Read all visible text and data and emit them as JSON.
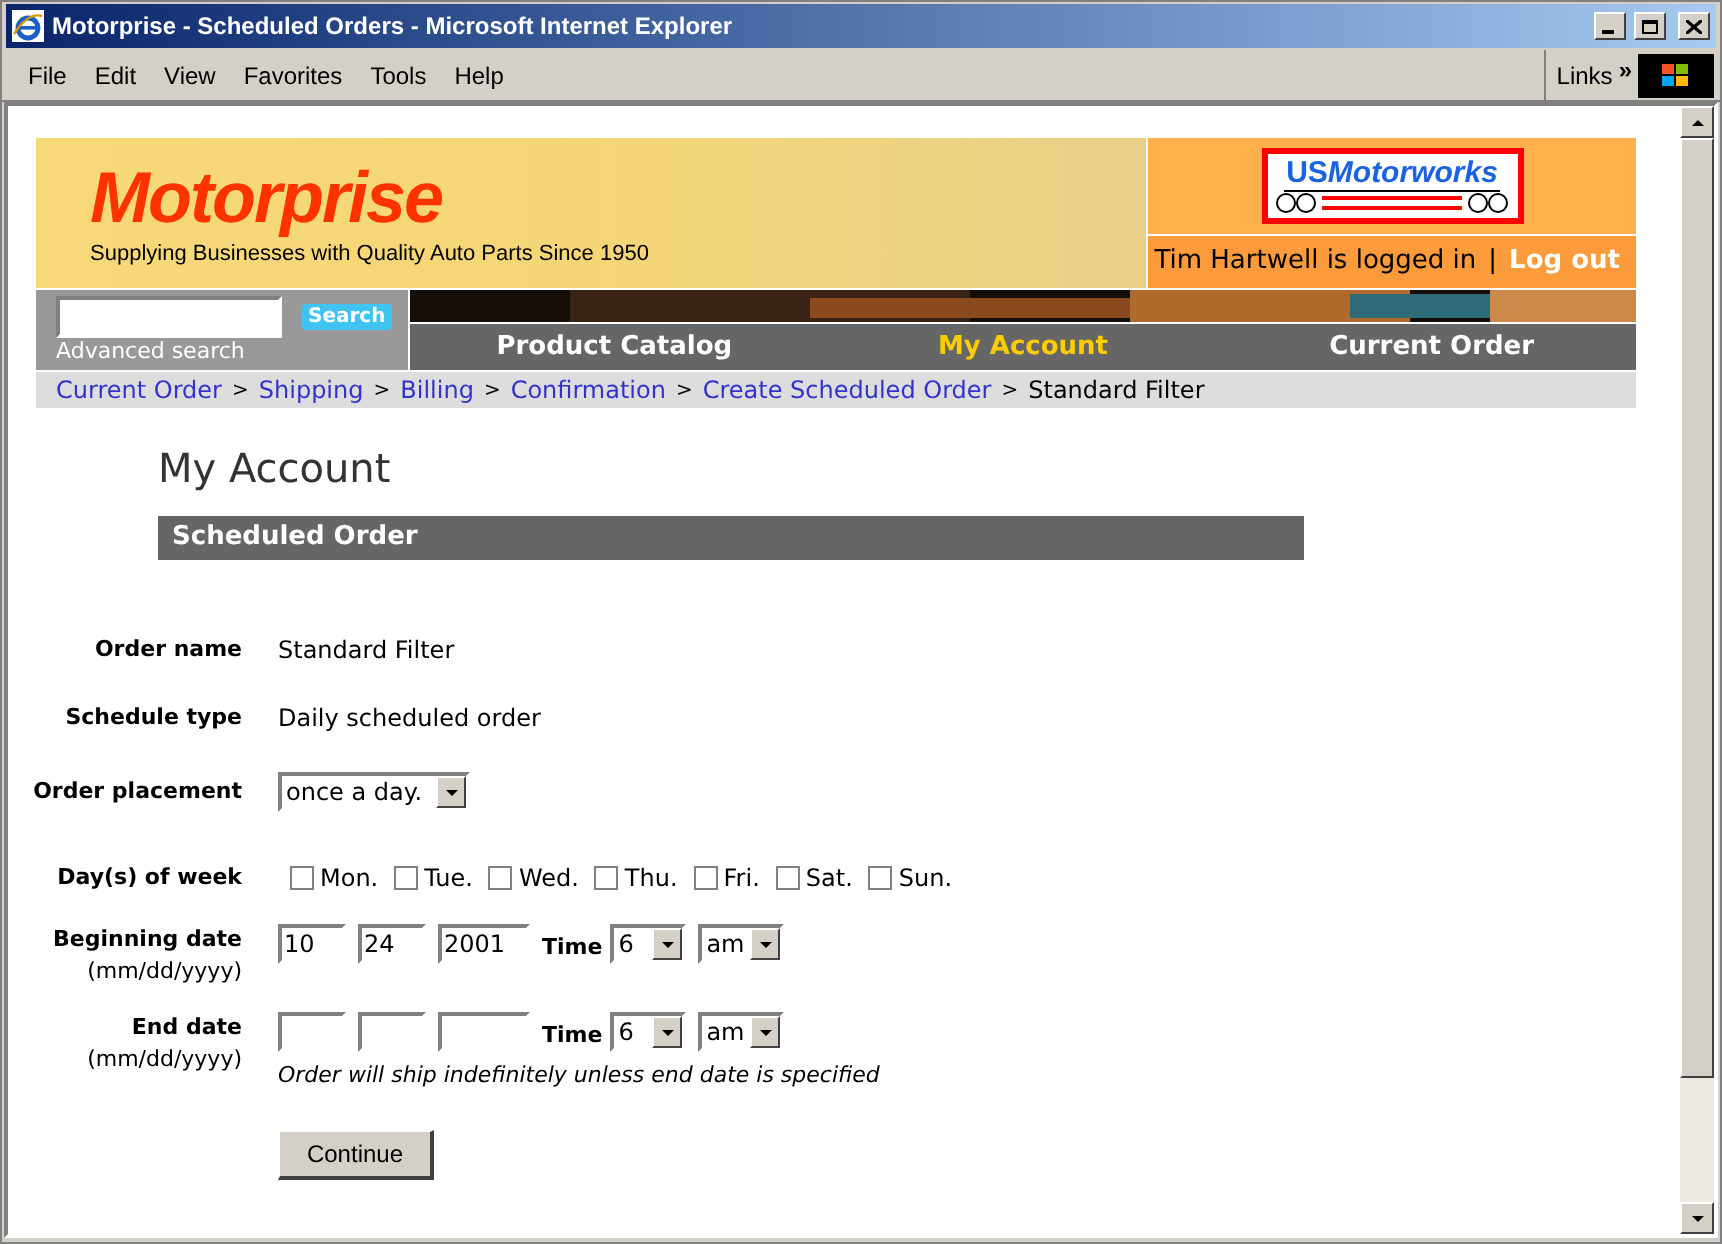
{
  "window": {
    "title": "Motorprise - Scheduled Orders - Microsoft Internet Explorer"
  },
  "menu": [
    {
      "label": "File"
    },
    {
      "label": "Edit"
    },
    {
      "label": "View"
    },
    {
      "label": "Favorites"
    },
    {
      "label": "Tools"
    },
    {
      "label": "Help"
    }
  ],
  "links": {
    "label": "Links",
    "chevron": "»"
  },
  "header": {
    "brand": "Motorprise",
    "tagline": "Supplying Businesses with Quality Auto Parts Since 1950",
    "partner_prefix": "US",
    "partner_name": "Motorworks",
    "user_text": "Tim Hartwell is logged in",
    "separator": "|",
    "logout": "Log out"
  },
  "search": {
    "button": "Search",
    "advanced": "Advanced search"
  },
  "nav": [
    {
      "label": "Product Catalog",
      "selected": false
    },
    {
      "label": "My Account",
      "selected": true
    },
    {
      "label": "Current Order",
      "selected": false
    }
  ],
  "breadcrumb": [
    {
      "kind": "link",
      "text": "Current Order"
    },
    {
      "kind": "sep",
      "text": ">"
    },
    {
      "kind": "link",
      "text": "Shipping"
    },
    {
      "kind": "sep",
      "text": ">"
    },
    {
      "kind": "link",
      "text": "Billing"
    },
    {
      "kind": "sep",
      "text": ">"
    },
    {
      "kind": "link",
      "text": "Confirmation"
    },
    {
      "kind": "sep",
      "text": ">"
    },
    {
      "kind": "link",
      "text": "Create Scheduled Order"
    },
    {
      "kind": "sep",
      "text": ">"
    },
    {
      "kind": "current",
      "text": "Standard Filter"
    }
  ],
  "page_title": "My Account",
  "section": "Scheduled Order",
  "form": [
    {
      "kind": "text",
      "label": "Order name",
      "value": "Standard Filter"
    },
    {
      "kind": "text",
      "label": "Schedule type",
      "value": "Daily scheduled order"
    },
    {
      "kind": "select",
      "label": "Order placement",
      "value": "once a day."
    },
    {
      "kind": "days",
      "label": "Day(s) of week",
      "days": [
        {
          "label": "Mon.",
          "checked": false
        },
        {
          "label": "Tue.",
          "checked": false
        },
        {
          "label": "Wed.",
          "checked": false
        },
        {
          "label": "Thu.",
          "checked": false
        },
        {
          "label": "Fri.",
          "checked": false
        },
        {
          "label": "Sat.",
          "checked": false
        },
        {
          "label": "Sun.",
          "checked": false
        }
      ]
    },
    {
      "kind": "date",
      "label": "Beginning date",
      "hint": "(mm/dd/yyyy)",
      "month": "10",
      "day": "24",
      "year": "2001",
      "time_label": "Time",
      "hour": "6",
      "ampm": "am"
    },
    {
      "kind": "date",
      "label": "End date",
      "hint": "(mm/dd/yyyy)",
      "time_label": "Time",
      "hour": "6",
      "ampm": "am",
      "note": "Order will ship indefinitely unless end date is specified"
    }
  ],
  "continue_button": "Continue"
}
